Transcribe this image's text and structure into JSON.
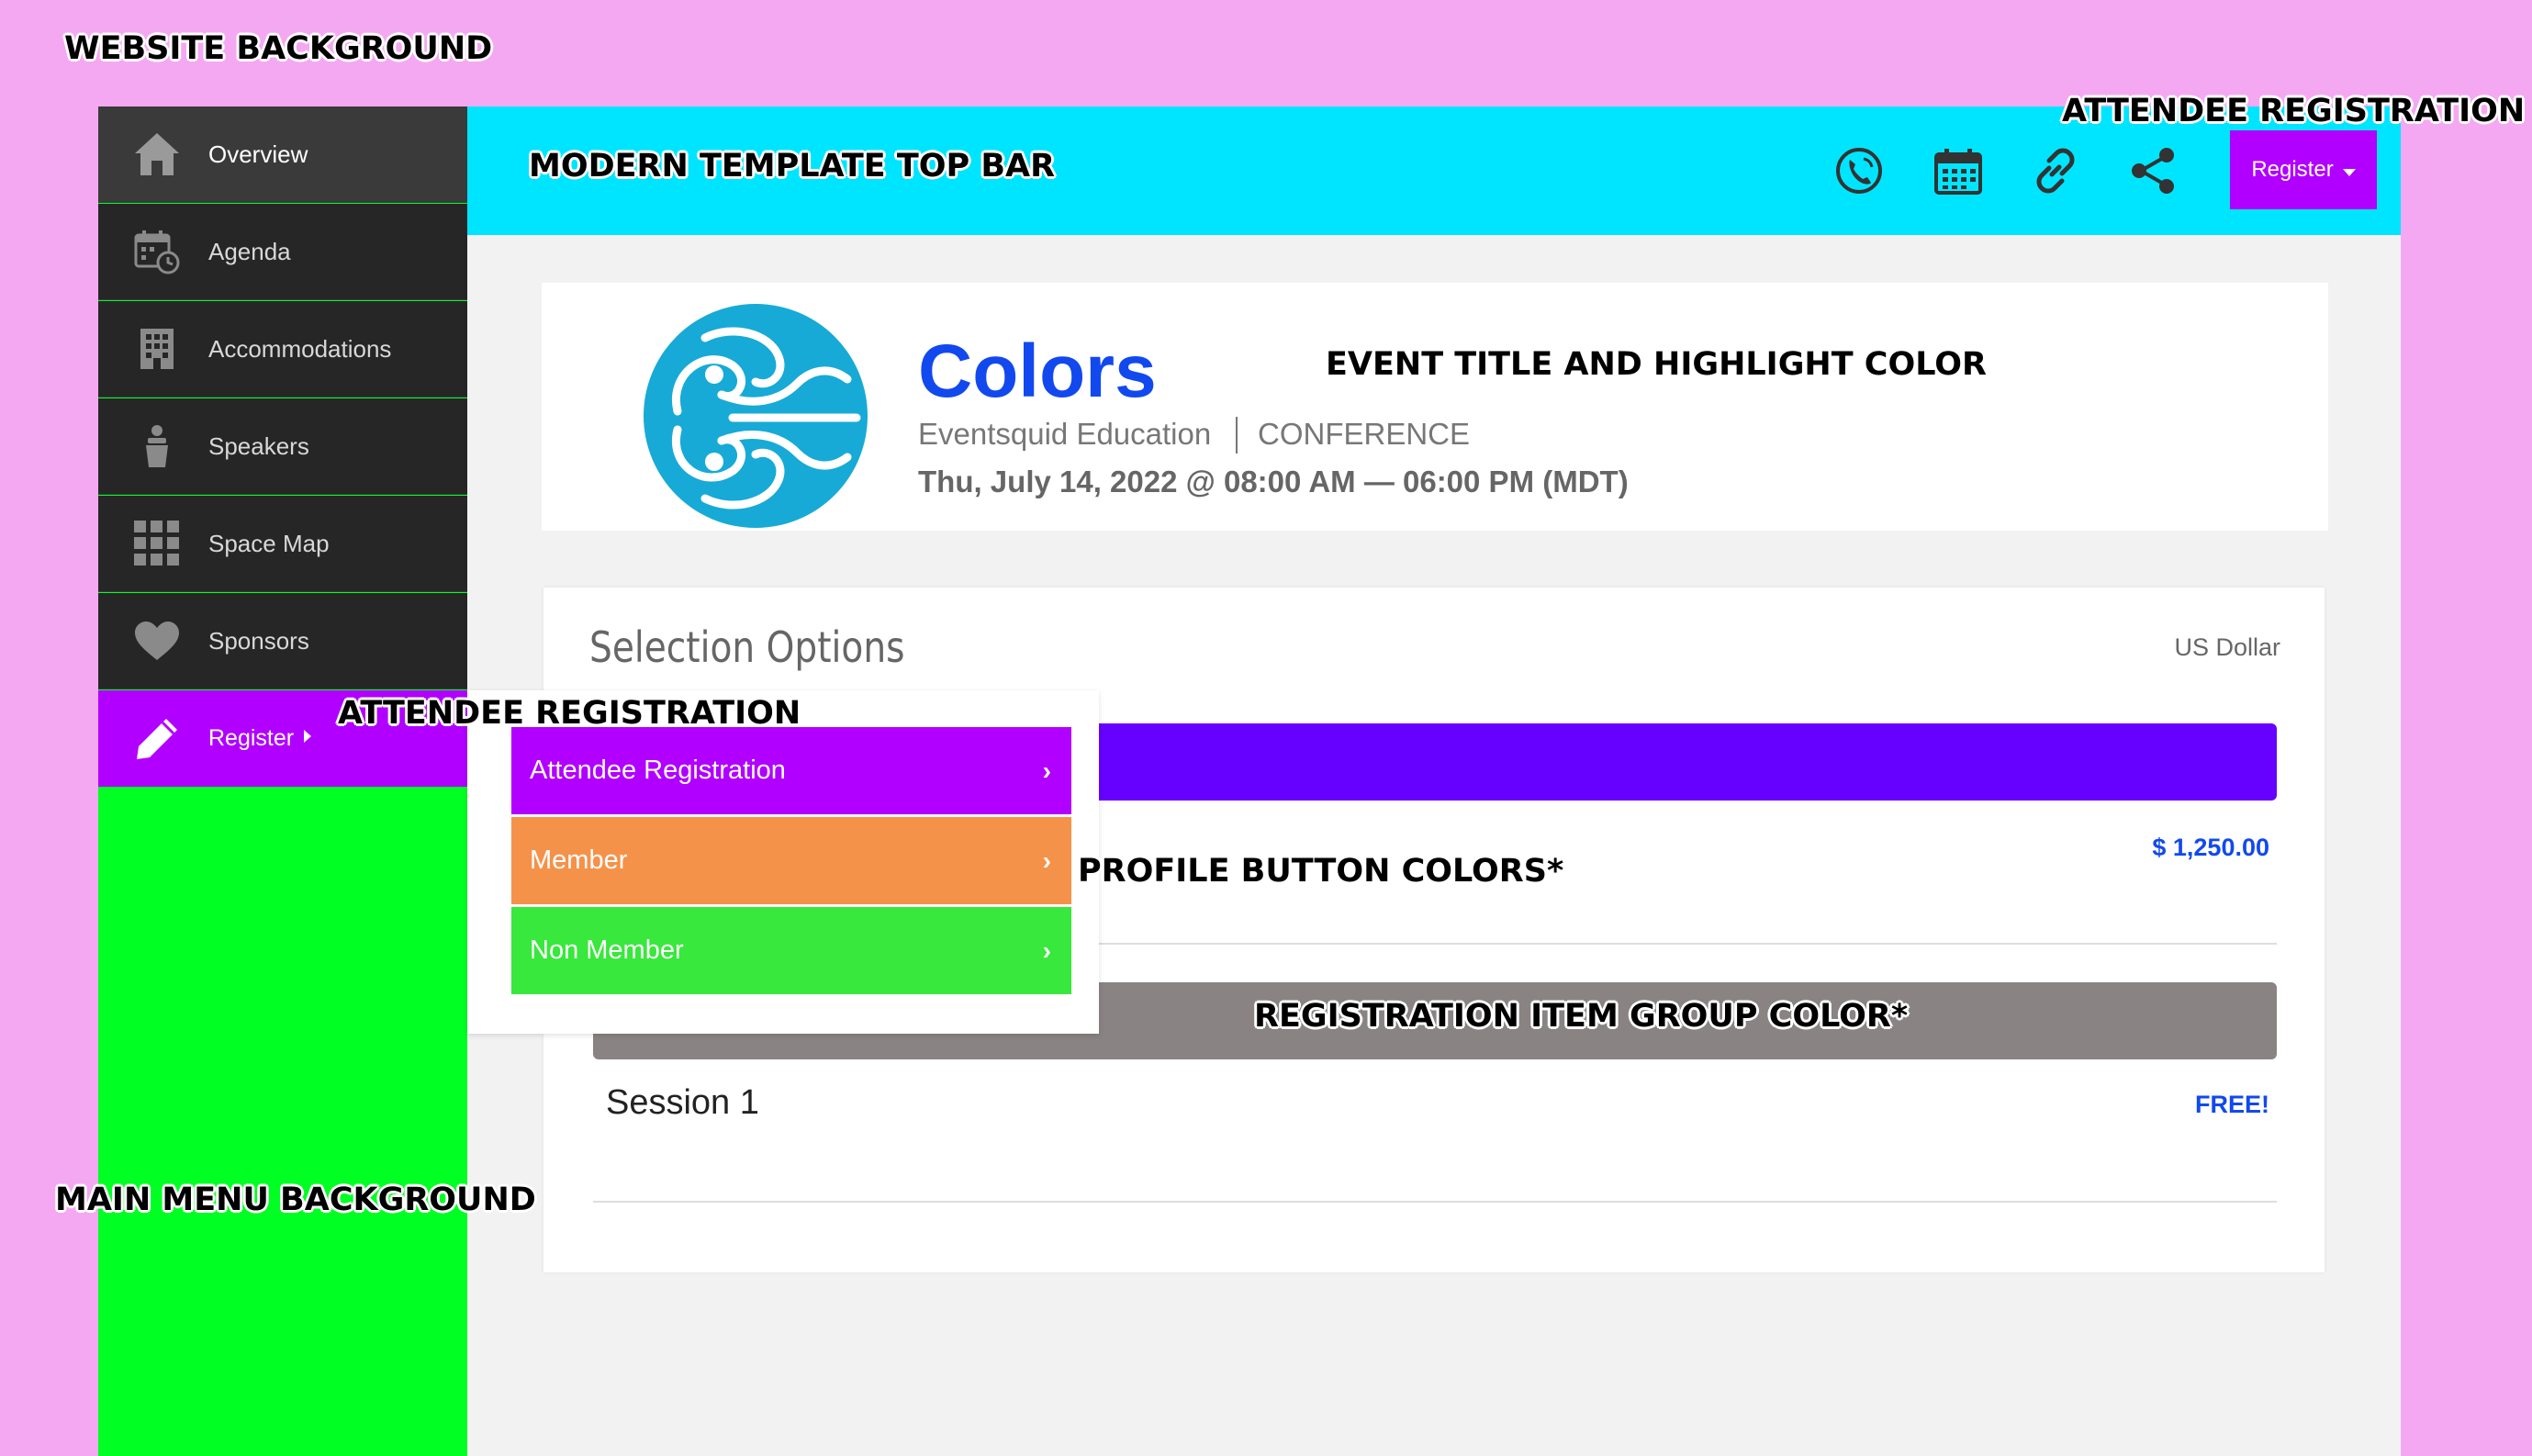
{
  "callouts": {
    "website_background": "WEBSITE BACKGROUND",
    "top_bar": "MODERN TEMPLATE TOP BAR",
    "attendee_registration_top": "ATTENDEE REGISTRATION",
    "attendee_registration_menu": "ATTENDEE REGISTRATION",
    "event_title": "EVENT TITLE AND HIGHLIGHT COLOR",
    "profile_buttons": "PROFILE BUTTON COLORS*",
    "item_group": "REGISTRATION ITEM GROUP COLOR*",
    "main_menu": "MAIN MENU BACKGROUND"
  },
  "sidebar": {
    "items": [
      {
        "label": "Overview",
        "icon": "home-icon"
      },
      {
        "label": "Agenda",
        "icon": "calendar-clock-icon"
      },
      {
        "label": "Accommodations",
        "icon": "building-icon"
      },
      {
        "label": "Speakers",
        "icon": "speaker-icon"
      },
      {
        "label": "Space Map",
        "icon": "grid-icon"
      },
      {
        "label": "Sponsors",
        "icon": "heart-icon"
      },
      {
        "label": "Register",
        "icon": "pencil-icon"
      }
    ]
  },
  "topbar": {
    "icons": [
      "phone-icon",
      "calendar-icon",
      "link-icon",
      "share-icon"
    ],
    "register_label": "Register"
  },
  "event": {
    "title": "Colors",
    "organization": "Eventsquid Education",
    "type": "CONFERENCE",
    "date": "Thu, July 14, 2022 @ 08:00 AM — 06:00 PM (MDT)"
  },
  "options": {
    "title": "Selection Options",
    "currency": "US Dollar",
    "price": "$ 1,250.00",
    "session": "Session 1",
    "session_price": "FREE!"
  },
  "dropdown": {
    "items": [
      {
        "label": "Attendee Registration",
        "color": "#b100ff"
      },
      {
        "label": "Member",
        "color": "#f5924a"
      },
      {
        "label": "Non Member",
        "color": "#38e83c"
      }
    ]
  },
  "colors": {
    "website_background": "#f5a8f2",
    "top_bar": "#00e5ff",
    "main_menu_background": "#00ff22",
    "register": "#b100ff",
    "highlight": "#1249ee",
    "item_group": "#898383",
    "profile_bar": "#6600ff"
  }
}
